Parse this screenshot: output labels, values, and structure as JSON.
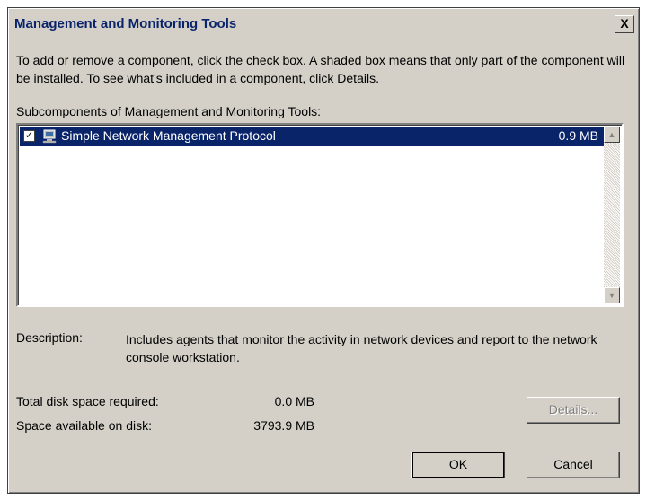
{
  "window": {
    "title": "Management and Monitoring Tools",
    "close_label": "X"
  },
  "intro_text": "To add or remove a component, click the check box. A shaded box means that only part of the component will be installed. To see what's included in a component, click Details.",
  "subcomponents": {
    "label": "Subcomponents of Management and Monitoring Tools:",
    "items": [
      {
        "label": "Simple Network Management Protocol",
        "size": "0.9 MB",
        "checked": true,
        "selected": true,
        "icon": "network-computer-icon"
      }
    ]
  },
  "description": {
    "label": "Description:",
    "text": "Includes agents that monitor the activity in network devices and report to the network console workstation."
  },
  "disk": {
    "required_label": "Total disk space required:",
    "required_value": "0.0 MB",
    "available_label": "Space available on disk:",
    "available_value": "3793.9 MB"
  },
  "buttons": {
    "details": "Details...",
    "ok": "OK",
    "cancel": "Cancel"
  },
  "colors": {
    "dialog_bg": "#d4d0c8",
    "selection": "#0a246a",
    "title_text": "#0a246a"
  }
}
